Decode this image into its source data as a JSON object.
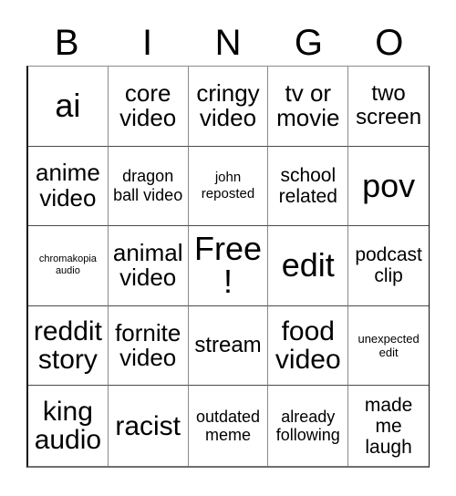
{
  "card": {
    "header_letters": [
      "B",
      "I",
      "N",
      "G",
      "O"
    ],
    "columns": 5,
    "rows": 5,
    "free_space_index": 12,
    "border_color": "#111111",
    "grid_line_color": "#8a8a8a",
    "background_color": "#ffffff",
    "text_color": "#000000"
  },
  "cells": [
    {
      "text": "ai",
      "size": "fs-huge"
    },
    {
      "text": "core video",
      "size": "fs-xl"
    },
    {
      "text": "cringy video",
      "size": "fs-xl"
    },
    {
      "text": "tv or movie",
      "size": "fs-xl"
    },
    {
      "text": "two screen",
      "size": "fs-l"
    },
    {
      "text": "anime video",
      "size": "fs-xl"
    },
    {
      "text": "dragon ball video",
      "size": "fs-m"
    },
    {
      "text": "john reposted",
      "size": "fs-s"
    },
    {
      "text": "school related",
      "size": "fs-ml"
    },
    {
      "text": "pov",
      "size": "fs-huge"
    },
    {
      "text": "chromakopia audio",
      "size": "fs-xxs"
    },
    {
      "text": "animal video",
      "size": "fs-xl"
    },
    {
      "text": "Free!",
      "size": "fs-huge"
    },
    {
      "text": "edit",
      "size": "fs-huge"
    },
    {
      "text": "podcast clip",
      "size": "fs-ml"
    },
    {
      "text": "reddit story",
      "size": "fs-xxl"
    },
    {
      "text": "fornite video",
      "size": "fs-xl"
    },
    {
      "text": "stream",
      "size": "fs-l"
    },
    {
      "text": "food video",
      "size": "fs-xxl"
    },
    {
      "text": "unexpected edit",
      "size": "fs-xs"
    },
    {
      "text": "king audio",
      "size": "fs-xxl"
    },
    {
      "text": "racist",
      "size": "fs-xxl"
    },
    {
      "text": "outdated meme",
      "size": "fs-m"
    },
    {
      "text": "already following",
      "size": "fs-m"
    },
    {
      "text": "made me laugh",
      "size": "fs-ml"
    }
  ]
}
